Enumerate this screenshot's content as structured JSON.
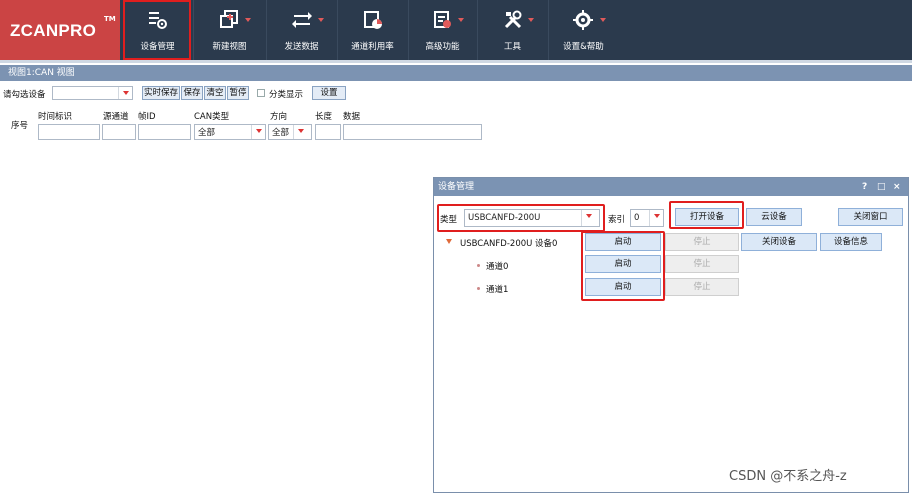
{
  "app": {
    "logo": "ZCANPRO",
    "logo_tm": "TM"
  },
  "toolbar": {
    "items": [
      {
        "label": "设备管理",
        "icon": "device-manage-icon"
      },
      {
        "label": "新建视图",
        "icon": "new-view-icon"
      },
      {
        "label": "发送数据",
        "icon": "send-data-icon"
      },
      {
        "label": "通道利用率",
        "icon": "channel-usage-icon"
      },
      {
        "label": "高级功能",
        "icon": "advanced-icon"
      },
      {
        "label": "工具",
        "icon": "tools-icon"
      },
      {
        "label": "设置&帮助",
        "icon": "settings-icon"
      }
    ]
  },
  "view": {
    "title": "视图1:CAN 视图",
    "select_device_label": "请勾选设备",
    "realtime_save": "实时保存",
    "save": "保存",
    "clear": "清空",
    "pause": "暂停",
    "classify_label": "分类显示",
    "settings_button": "设置",
    "columns": {
      "index": "序号",
      "timestamp": "时间标识",
      "source_channel": "源通道",
      "frame_id": "帧ID",
      "can_type": "CAN类型",
      "direction": "方向",
      "length": "长度",
      "data": "数据"
    },
    "can_type_value": "全部",
    "direction_value": "全部"
  },
  "dialog": {
    "title": "设备管理",
    "help": "?",
    "restore": "□",
    "close": "×",
    "type_label": "类型",
    "type_value": "USBCANFD-200U",
    "index_label": "索引",
    "index_value": "0",
    "open_device": "打开设备",
    "cloud_device": "云设备",
    "close_window": "关闭窗口",
    "device_node": "USBCANFD-200U 设备0",
    "start": "启动",
    "stop": "停止",
    "close_device": "关闭设备",
    "device_info": "设备信息",
    "channels": [
      {
        "label": "通道0",
        "start": "启动",
        "stop": "停止"
      },
      {
        "label": "通道1",
        "start": "启动",
        "stop": "停止"
      }
    ]
  },
  "watermark": "CSDN @不系之舟-z"
}
